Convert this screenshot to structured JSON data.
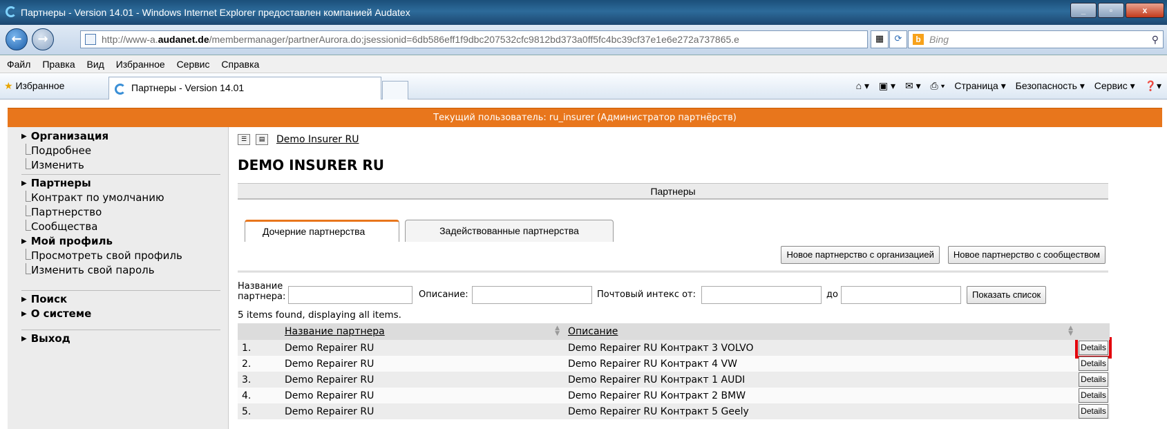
{
  "window": {
    "title": "Партнеры - Version 14.01 - Windows Internet Explorer предоставлен компанией Audatex",
    "controls": [
      "minimize",
      "maximize",
      "close"
    ]
  },
  "address_bar": {
    "url_prefix": "http://www-a.",
    "url_domain": "audanet.de",
    "url_rest": "/membermanager/partnerAurora.do;jsessionid=6db586eff1f9dbc207532cfc9812bd373a0ff5fc4bc39cf37e1e6e272a737865.e",
    "search_placeholder": "Bing"
  },
  "menu": [
    "Файл",
    "Правка",
    "Вид",
    "Избранное",
    "Сервис",
    "Справка"
  ],
  "favorites_bar": {
    "favorites_label": "Избранное",
    "tab_title": "Партнеры - Version 14.01",
    "tools": [
      "Страница ▾",
      "Безопасность ▾",
      "Сервис ▾"
    ]
  },
  "user_bar": "Текущий пользователь: ru_insurer  (Администратор партнёрств)",
  "sidebar": {
    "sections": [
      {
        "label": "Организация",
        "items": [
          "Подробнее",
          "Изменить"
        ]
      },
      {
        "label": "Партнеры",
        "items": [
          "Контракт по умолчанию",
          "Партнерство",
          "Сообщества"
        ]
      },
      {
        "label": "Мой профиль",
        "items": [
          "Просмотреть свой профиль",
          "Изменить свой пароль"
        ]
      },
      {
        "label": "Поиск",
        "items": []
      },
      {
        "label": "О системе",
        "items": []
      },
      {
        "label": "Выход",
        "items": []
      }
    ]
  },
  "main": {
    "breadcrumb": "Demo Insurer RU",
    "title": "DEMO INSURER RU",
    "section_bar": "Партнеры",
    "tabs": [
      {
        "label": "Дочерние партнерства",
        "active": true
      },
      {
        "label": "Задействованные партнерства",
        "active": false
      }
    ],
    "buttons": {
      "new_org": "Новое партнерство с организацией",
      "new_community": "Новое партнерство с сообществом"
    },
    "filters": {
      "name_label_1": "Название",
      "name_label_2": "партнера:",
      "desc_label": "Описание:",
      "zip_from_label": "Почтовый интекс от:",
      "zip_to_label": "до",
      "show_button": "Показать список"
    },
    "found_text": "5 items found, displaying all items.",
    "table": {
      "columns": [
        "Название партнера",
        "Описание"
      ],
      "rows": [
        {
          "num": "1.",
          "name": "Demo Repairer RU",
          "desc": "Demo Repairer RU Контракт 3 VOLVO",
          "action": "Details",
          "highlighted": true
        },
        {
          "num": "2.",
          "name": "Demo Repairer RU",
          "desc": "Demo Repairer RU Контракт 4 VW",
          "action": "Details",
          "highlighted": false
        },
        {
          "num": "3.",
          "name": "Demo Repairer RU",
          "desc": "Demo Repairer RU Контракт 1 AUDI",
          "action": "Details",
          "highlighted": false
        },
        {
          "num": "4.",
          "name": "Demo Repairer RU",
          "desc": "Demo Repairer RU Контракт 2 BMW",
          "action": "Details",
          "highlighted": false
        },
        {
          "num": "5.",
          "name": "Demo Repairer RU",
          "desc": "Demo Repairer RU Контракт 5 Geely",
          "action": "Details",
          "highlighted": false
        }
      ]
    }
  },
  "colors": {
    "accent": "#e8761c",
    "highlight": "#e3000b"
  }
}
